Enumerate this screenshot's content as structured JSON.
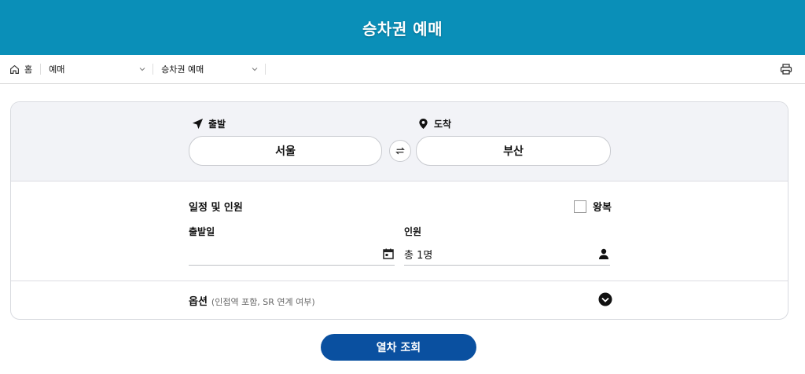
{
  "header": {
    "title": "승차권 예매"
  },
  "breadcrumb": {
    "home_label": "홈",
    "select1": "예매",
    "select2": "승차권 예매"
  },
  "route": {
    "departure_label": "출발",
    "departure_value": "서울",
    "arrival_label": "도착",
    "arrival_value": "부산"
  },
  "schedule": {
    "title": "일정 및 인원",
    "round_trip_label": "왕복",
    "date_label": "출발일",
    "date_value": "",
    "people_label": "인원",
    "people_value": "총 1명"
  },
  "options": {
    "title": "옵션",
    "subtitle": "(인접역 포함, SR 연계 여부)"
  },
  "search_button": "열차 조회",
  "colors": {
    "header_bg": "#0a8fb8",
    "button_bg": "#0a50a0",
    "panel_bg": "#f2f3f7"
  }
}
